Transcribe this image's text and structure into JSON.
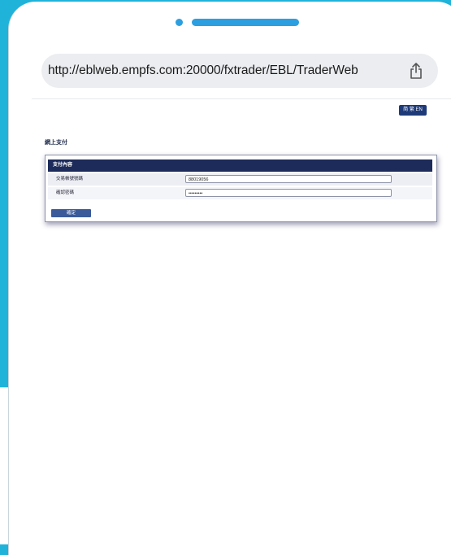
{
  "browser": {
    "url": "http://eblweb.empfs.com:20000/fxtrader/EBL/TraderWeb"
  },
  "page": {
    "language_button": "简 繁 EN",
    "title": "網上支付",
    "panel": {
      "header": "支付內容",
      "rows": [
        {
          "label": "交易帳號號碼",
          "value": "88019056"
        },
        {
          "label": "確認密碼",
          "value": "•••••••••"
        }
      ],
      "confirm_button": "確定"
    }
  },
  "colors": {
    "frame": "#1fb3da",
    "accent": "#2c9fe0",
    "panel_header": "#1c2b5a"
  }
}
